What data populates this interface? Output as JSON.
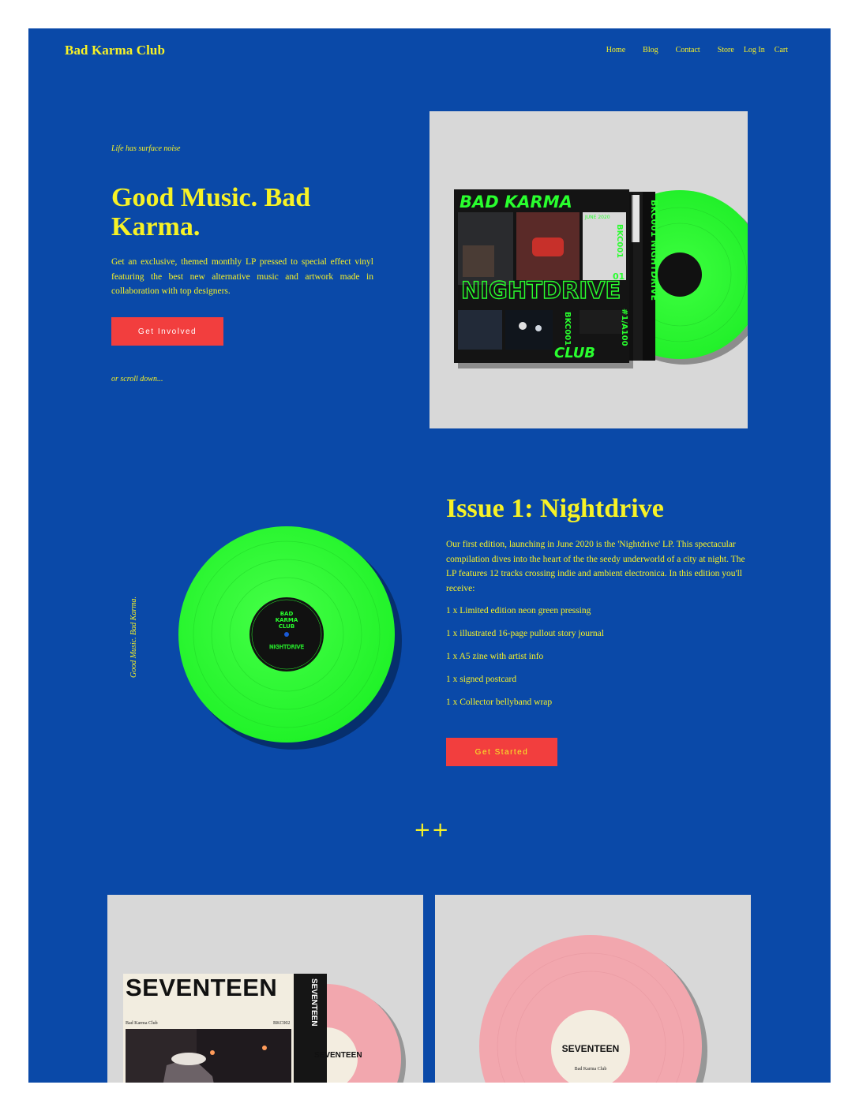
{
  "header": {
    "brand": "Bad Karma Club",
    "nav": [
      "Home",
      "Blog",
      "Contact",
      "Store",
      "Log In",
      "Cart"
    ]
  },
  "hero": {
    "tagline": "Life has surface noise",
    "title": "Good Music. Bad Karma.",
    "description": "Get an exclusive, themed monthly LP pressed to special effect vinyl featuring the best new alternative music and artwork made in collaboration with top designers.",
    "cta": "Get Involved",
    "scroll_hint": "or scroll down...",
    "cover": {
      "top_text": "BAD KARMA",
      "date": "JUNE 2020",
      "catalog": "BKC001",
      "title": "NIGHTDRIVE",
      "number": "01",
      "bottom_text": "CLUB",
      "edition": "#1/A100"
    }
  },
  "issue": {
    "vertical_text": "Good Music. Bad Karma.",
    "title": "Issue 1: Nightdrive",
    "description": "Our first edition, launching in June 2020 is the 'Nightdrive' LP. This spectacular compilation dives into the heart of the the seedy underworld of a city at night. The LP features 12 tracks crossing indie and ambient electronica. In this edition you'll receive:",
    "items": [
      "1 x Limited edition neon green pressing",
      "1 x illustrated 16-page pullout story journal",
      "1 x A5 zine with artist info",
      "1 x signed postcard",
      "1 x Collector bellyband wrap"
    ],
    "cta": "Get Started",
    "disc_label": {
      "line1": "BAD",
      "line2": "KARMA",
      "line3": "CLUB",
      "title": "NIGHTDRIVE"
    }
  },
  "separator": "++",
  "bottom": {
    "cover_title": "SEVENTEEN",
    "cover_brand": "Bad Karma Club",
    "cover_code": "BKC002",
    "spine_text": "SEVENTEEN",
    "disc_label_title": "SEVENTEEN",
    "disc_label_brand": "Bad Karma Club"
  },
  "colors": {
    "background": "#0a49a8",
    "accent_yellow": "#f7f226",
    "button_red": "#f23e3e",
    "panel_gray": "#d8d8d8",
    "neon_green": "#29ff2e",
    "pink_vinyl": "#f2a7ae"
  }
}
